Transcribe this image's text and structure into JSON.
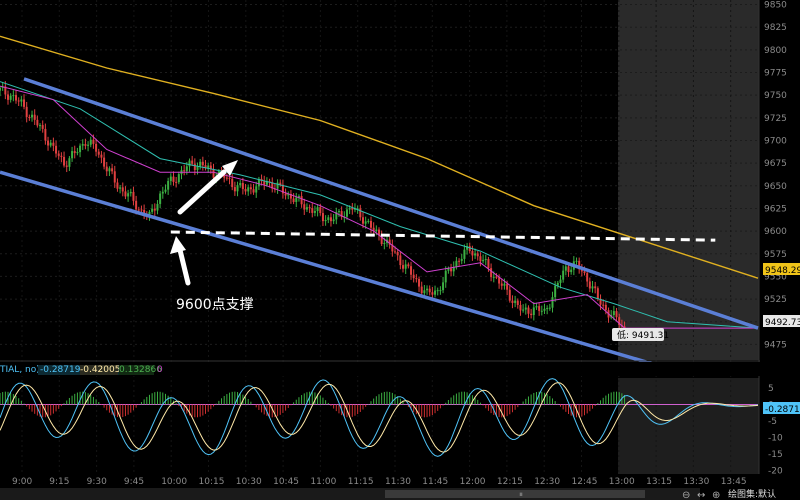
{
  "chart_data": {
    "type": "candlestick",
    "time_labels": [
      "9:00",
      "9:15",
      "9:30",
      "9:45",
      "10:00",
      "10:15",
      "10:30",
      "10:45",
      "11:00",
      "11:15",
      "11:30",
      "11:45",
      "12:00",
      "12:15",
      "12:30",
      "12:45",
      "13:00",
      "13:15",
      "13:30",
      "13:45"
    ],
    "price_ticks": [
      "9850",
      "9825",
      "9800",
      "9775",
      "9750",
      "9725",
      "9700",
      "9675",
      "9650",
      "9625",
      "9600",
      "9575",
      "9550",
      "9525",
      "9500",
      "9475"
    ],
    "price_range": [
      9460,
      9855
    ],
    "close_series": [
      [
        0,
        9755
      ],
      [
        4,
        9750
      ],
      [
        8,
        9740
      ],
      [
        12,
        9725
      ],
      [
        16,
        9710
      ],
      [
        20,
        9690
      ],
      [
        24,
        9675
      ],
      [
        28,
        9685
      ],
      [
        32,
        9700
      ],
      [
        36,
        9690
      ],
      [
        40,
        9670
      ],
      [
        44,
        9650
      ],
      [
        48,
        9640
      ],
      [
        52,
        9625
      ],
      [
        56,
        9615
      ],
      [
        60,
        9640
      ],
      [
        64,
        9655
      ],
      [
        68,
        9665
      ],
      [
        72,
        9675
      ],
      [
        76,
        9672
      ],
      [
        80,
        9665
      ],
      [
        84,
        9660
      ],
      [
        88,
        9650
      ],
      [
        92,
        9645
      ],
      [
        96,
        9650
      ],
      [
        100,
        9655
      ],
      [
        104,
        9648
      ],
      [
        108,
        9640
      ],
      [
        112,
        9632
      ],
      [
        116,
        9625
      ],
      [
        120,
        9618
      ],
      [
        124,
        9612
      ],
      [
        128,
        9620
      ],
      [
        132,
        9625
      ],
      [
        136,
        9615
      ],
      [
        140,
        9600
      ],
      [
        144,
        9590
      ],
      [
        148,
        9575
      ],
      [
        152,
        9560
      ],
      [
        156,
        9545
      ],
      [
        160,
        9530
      ],
      [
        164,
        9535
      ],
      [
        168,
        9555
      ],
      [
        172,
        9570
      ],
      [
        176,
        9580
      ],
      [
        180,
        9570
      ],
      [
        184,
        9555
      ],
      [
        188,
        9540
      ],
      [
        192,
        9525
      ],
      [
        196,
        9510
      ],
      [
        200,
        9515
      ],
      [
        204,
        9510
      ],
      [
        208,
        9535
      ],
      [
        212,
        9560
      ],
      [
        216,
        9563
      ],
      [
        220,
        9548
      ],
      [
        224,
        9525
      ],
      [
        228,
        9510
      ],
      [
        232,
        9500
      ],
      [
        234,
        9492
      ]
    ],
    "ma_yellow": [
      [
        0,
        9815
      ],
      [
        40,
        9780
      ],
      [
        80,
        9752
      ],
      [
        120,
        9722
      ],
      [
        160,
        9680
      ],
      [
        200,
        9628
      ],
      [
        240,
        9590
      ],
      [
        284,
        9548
      ]
    ],
    "ma_teal": [
      [
        0,
        9765
      ],
      [
        30,
        9735
      ],
      [
        60,
        9680
      ],
      [
        90,
        9662
      ],
      [
        120,
        9640
      ],
      [
        150,
        9605
      ],
      [
        180,
        9578
      ],
      [
        210,
        9538
      ],
      [
        230,
        9520
      ],
      [
        250,
        9500
      ],
      [
        284,
        9493
      ]
    ],
    "ma_magenta": [
      [
        0,
        9760
      ],
      [
        20,
        9745
      ],
      [
        40,
        9690
      ],
      [
        60,
        9665
      ],
      [
        80,
        9665
      ],
      [
        100,
        9650
      ],
      [
        120,
        9628
      ],
      [
        140,
        9600
      ],
      [
        160,
        9555
      ],
      [
        180,
        9565
      ],
      [
        200,
        9520
      ],
      [
        220,
        9530
      ],
      [
        234,
        9493
      ],
      [
        284,
        9493
      ]
    ],
    "channel_upper": [
      [
        9,
        9768
      ],
      [
        284,
        9493
      ]
    ],
    "channel_lower": [
      [
        0,
        9665
      ],
      [
        252,
        9447
      ]
    ],
    "support_line": [
      [
        64,
        9599
      ],
      [
        268,
        9590
      ]
    ],
    "last_price": "9492.73",
    "yellow_ma_value": "9548.29",
    "low_label": "低: 9491.31",
    "annotation": "9600点支撑",
    "indicator": {
      "legend_prefix": "TIAL, no)",
      "values": [
        "-0.287191",
        "-0.420057",
        "0.132866",
        "0"
      ],
      "colors": [
        "#4fc3f7",
        "#ffe9a8",
        "#4caf50",
        "#c040c0"
      ],
      "ticks": [
        "5",
        "0",
        "-5",
        "-10",
        "-15",
        "-20"
      ],
      "range": [
        -21,
        8
      ],
      "current": "-0.2871"
    },
    "footer_text": "绘图集:默认"
  }
}
